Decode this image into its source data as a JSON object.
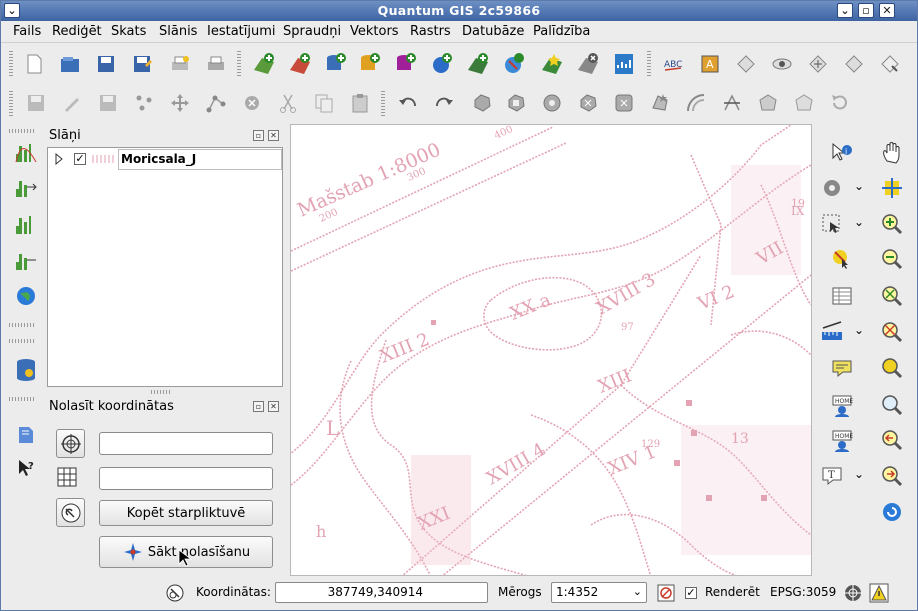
{
  "window": {
    "title": "Quantum GIS 2c59866"
  },
  "menu": [
    "Fails",
    "Rediģēt",
    "Skats",
    "Slānis",
    "Iestatījumi",
    "Spraudņi",
    "Vektors",
    "Rastrs",
    "Datubāze",
    "Palīdzība"
  ],
  "layers_panel": {
    "title": "Slāņi",
    "layers": [
      {
        "name": "Moricsala_J",
        "checked": true
      }
    ]
  },
  "coord_panel": {
    "title": "Nolasīt koordinātas",
    "field1_value": "",
    "field2_value": "",
    "copy_button": "Kopēt starpliktuvē",
    "start_button": "Sākt nolasīšanu"
  },
  "statusbar": {
    "coords_label": "Koordinātas:",
    "coords_value": "387749,340914",
    "scale_label": "Mērogs",
    "scale_value": "1:4352",
    "render_label": "Renderēt",
    "render_checked": true,
    "crs": "EPSG:3059"
  },
  "map": {
    "labels": [
      "Mašstab 1:8000",
      "300",
      "400",
      "200",
      "XX a",
      "XVIII 3",
      "XIII 2",
      "XIII",
      "XVIII 4",
      "XIV 1",
      "VI 2",
      "VII",
      "IX",
      "19",
      "13",
      "XXI",
      "L",
      "h",
      "97",
      "129"
    ]
  },
  "colors": {
    "map_ink": "#e3a3b3",
    "title_bar": "#4a6fae"
  }
}
